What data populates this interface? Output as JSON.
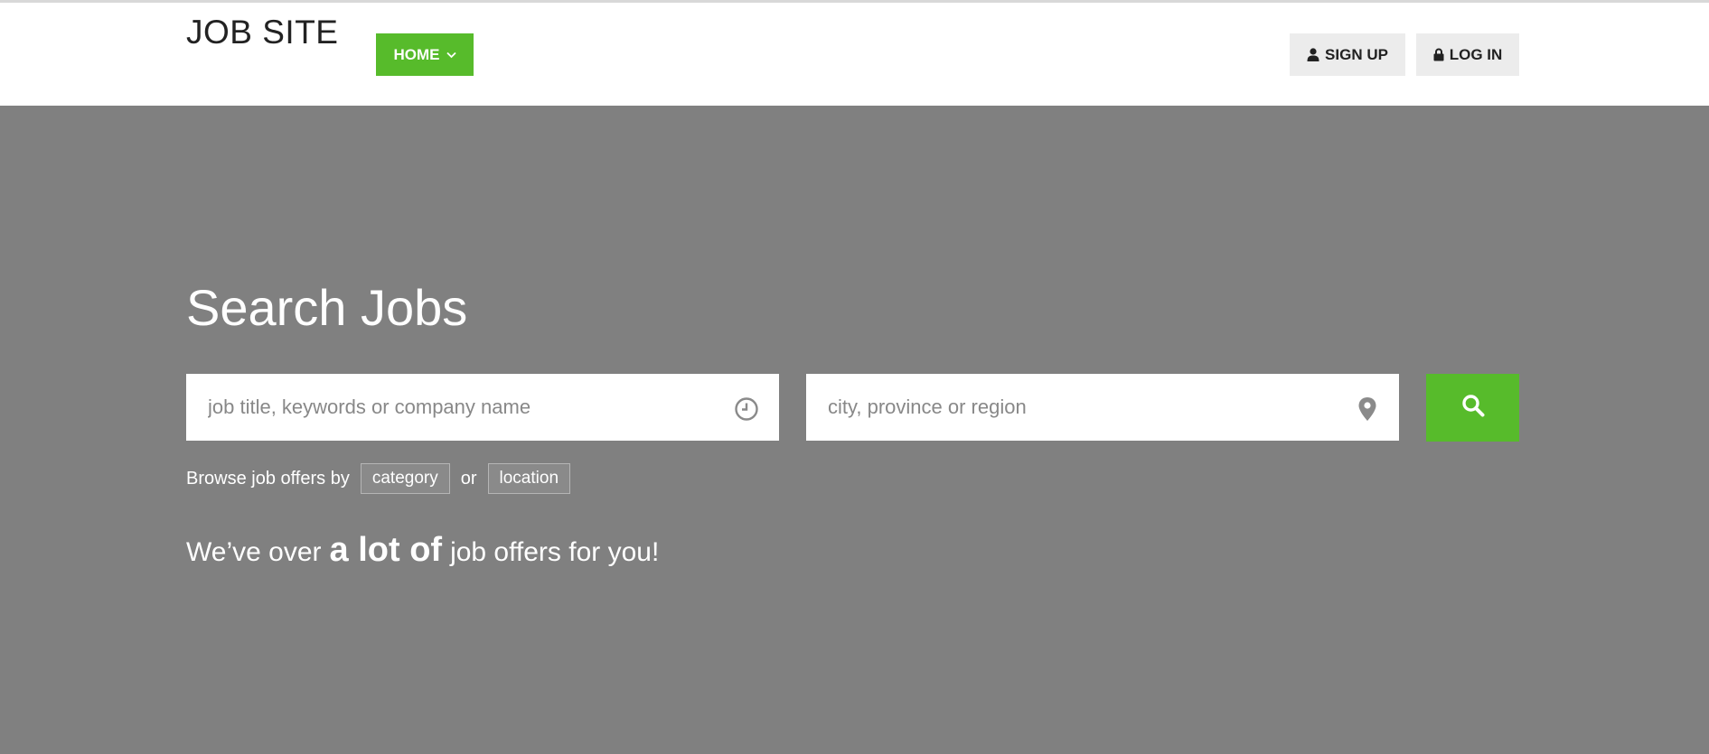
{
  "header": {
    "logo": "JOB SITE",
    "home_label": "HOME",
    "signup_label": "SIGN UP",
    "login_label": "LOG IN"
  },
  "hero": {
    "title": "Search Jobs",
    "keyword_placeholder": "job title, keywords or company name",
    "location_placeholder": "city, province or region",
    "browse_prefix": "Browse job offers by",
    "category_label": "category",
    "or_text": "or",
    "location_label": "location",
    "tagline_before": "We’ve over",
    "tagline_emphasis": "a lot of",
    "tagline_after": "job offers for you!"
  },
  "icons": {
    "home_dropdown": "chevron-down-icon",
    "signup": "user-icon",
    "login": "lock-icon",
    "keyword_field": "clock-icon",
    "location_field": "map-pin-icon",
    "search": "search-icon"
  },
  "colors": {
    "accent": "#57bb2b",
    "hero_background": "#808080",
    "header_background": "#ffffff",
    "auth_button_background": "#ececec"
  }
}
